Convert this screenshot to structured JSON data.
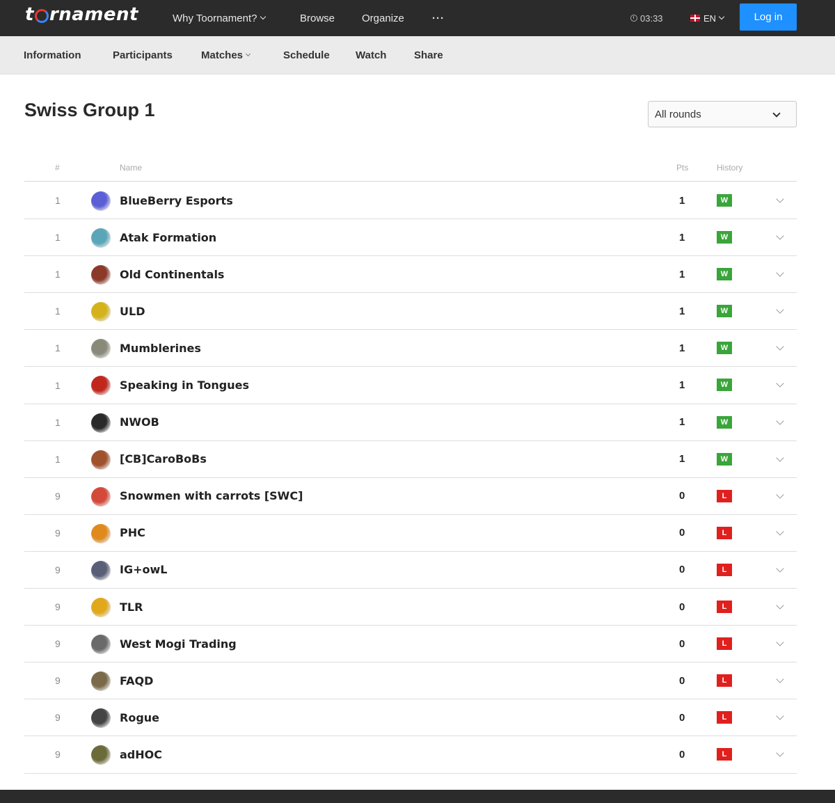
{
  "brand": {
    "logo_left": "t",
    "logo_right": "rnament"
  },
  "topnav": {
    "why": "Why Toornament?",
    "browse": "Browse",
    "organize": "Organize",
    "more": "···",
    "time": "03:33",
    "lang": "EN",
    "login": "Log in"
  },
  "subnav": {
    "information": "Information",
    "participants": "Participants",
    "matches": "Matches",
    "schedule": "Schedule",
    "watch": "Watch",
    "share": "Share"
  },
  "page": {
    "title": "Swiss Group 1",
    "round_filter": "All rounds"
  },
  "table": {
    "headers": {
      "rank": "#",
      "name": "Name",
      "pts": "Pts",
      "history": "History"
    },
    "rows": [
      {
        "rank": "1",
        "name": "BlueBerry Esports",
        "pts": "1",
        "history": "W",
        "logo_color": "#5b5fd6"
      },
      {
        "rank": "1",
        "name": "Atak Formation",
        "pts": "1",
        "history": "W",
        "logo_color": "#5aa6b8"
      },
      {
        "rank": "1",
        "name": "Old Continentals",
        "pts": "1",
        "history": "W",
        "logo_color": "#8b3a2a"
      },
      {
        "rank": "1",
        "name": "ULD",
        "pts": "1",
        "history": "W",
        "logo_color": "#d4b21a"
      },
      {
        "rank": "1",
        "name": "Mumblerines",
        "pts": "1",
        "history": "W",
        "logo_color": "#8a8a7a"
      },
      {
        "rank": "1",
        "name": "Speaking in Tongues",
        "pts": "1",
        "history": "W",
        "logo_color": "#c0281e"
      },
      {
        "rank": "1",
        "name": "NWOB",
        "pts": "1",
        "history": "W",
        "logo_color": "#2a2a2a"
      },
      {
        "rank": "1",
        "name": "[CB]CaroBoBs",
        "pts": "1",
        "history": "W",
        "logo_color": "#a0522d"
      },
      {
        "rank": "9",
        "name": "Snowmen with carrots [SWC]",
        "pts": "0",
        "history": "L",
        "logo_color": "#d44a3a"
      },
      {
        "rank": "9",
        "name": "PHC",
        "pts": "0",
        "history": "L",
        "logo_color": "#e08a1e"
      },
      {
        "rank": "9",
        "name": "IG+owL",
        "pts": "0",
        "history": "L",
        "logo_color": "#5a5f78"
      },
      {
        "rank": "9",
        "name": "TLR",
        "pts": "0",
        "history": "L",
        "logo_color": "#e0a81a"
      },
      {
        "rank": "9",
        "name": "West Mogi Trading",
        "pts": "0",
        "history": "L",
        "logo_color": "#6a6a6a"
      },
      {
        "rank": "9",
        "name": "FAQD",
        "pts": "0",
        "history": "L",
        "logo_color": "#7a6a4a"
      },
      {
        "rank": "9",
        "name": "Rogue",
        "pts": "0",
        "history": "L",
        "logo_color": "#444444"
      },
      {
        "rank": "9",
        "name": "adHOC",
        "pts": "0",
        "history": "L",
        "logo_color": "#6b6b3a"
      }
    ]
  },
  "colors": {
    "win": "#3aa53a",
    "loss": "#e0201e",
    "accent": "#1e90ff",
    "topbar": "#2b2b2b"
  }
}
